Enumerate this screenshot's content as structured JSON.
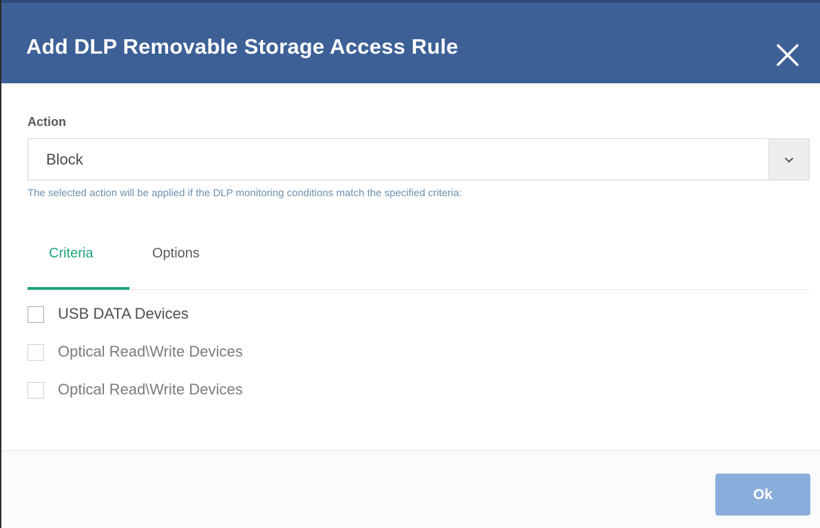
{
  "dialog": {
    "title": "Add DLP Removable Storage Access Rule",
    "close_icon": "close-icon"
  },
  "action": {
    "label": "Action",
    "selected_value": "Block",
    "dropdown_icon": "chevron-down-icon",
    "help_text": "The selected action will be applied if the DLP monitoring conditions match the specified criteria:"
  },
  "tabs": {
    "items": [
      {
        "label": "Criteria",
        "active": true
      },
      {
        "label": "Options",
        "active": false
      }
    ]
  },
  "criteria": {
    "items": [
      {
        "label": "USB DATA Devices",
        "checked": false
      },
      {
        "label": "Optical Read\\Write Devices",
        "checked": false
      },
      {
        "label": "Optical Read\\Write Devices",
        "checked": false
      }
    ]
  },
  "footer": {
    "ok_label": "Ok"
  },
  "colors": {
    "header_bg": "#3d6097",
    "tab_active": "#1fa37c",
    "help_text": "#6f8fae",
    "ok_button_bg": "#8aaedb"
  }
}
